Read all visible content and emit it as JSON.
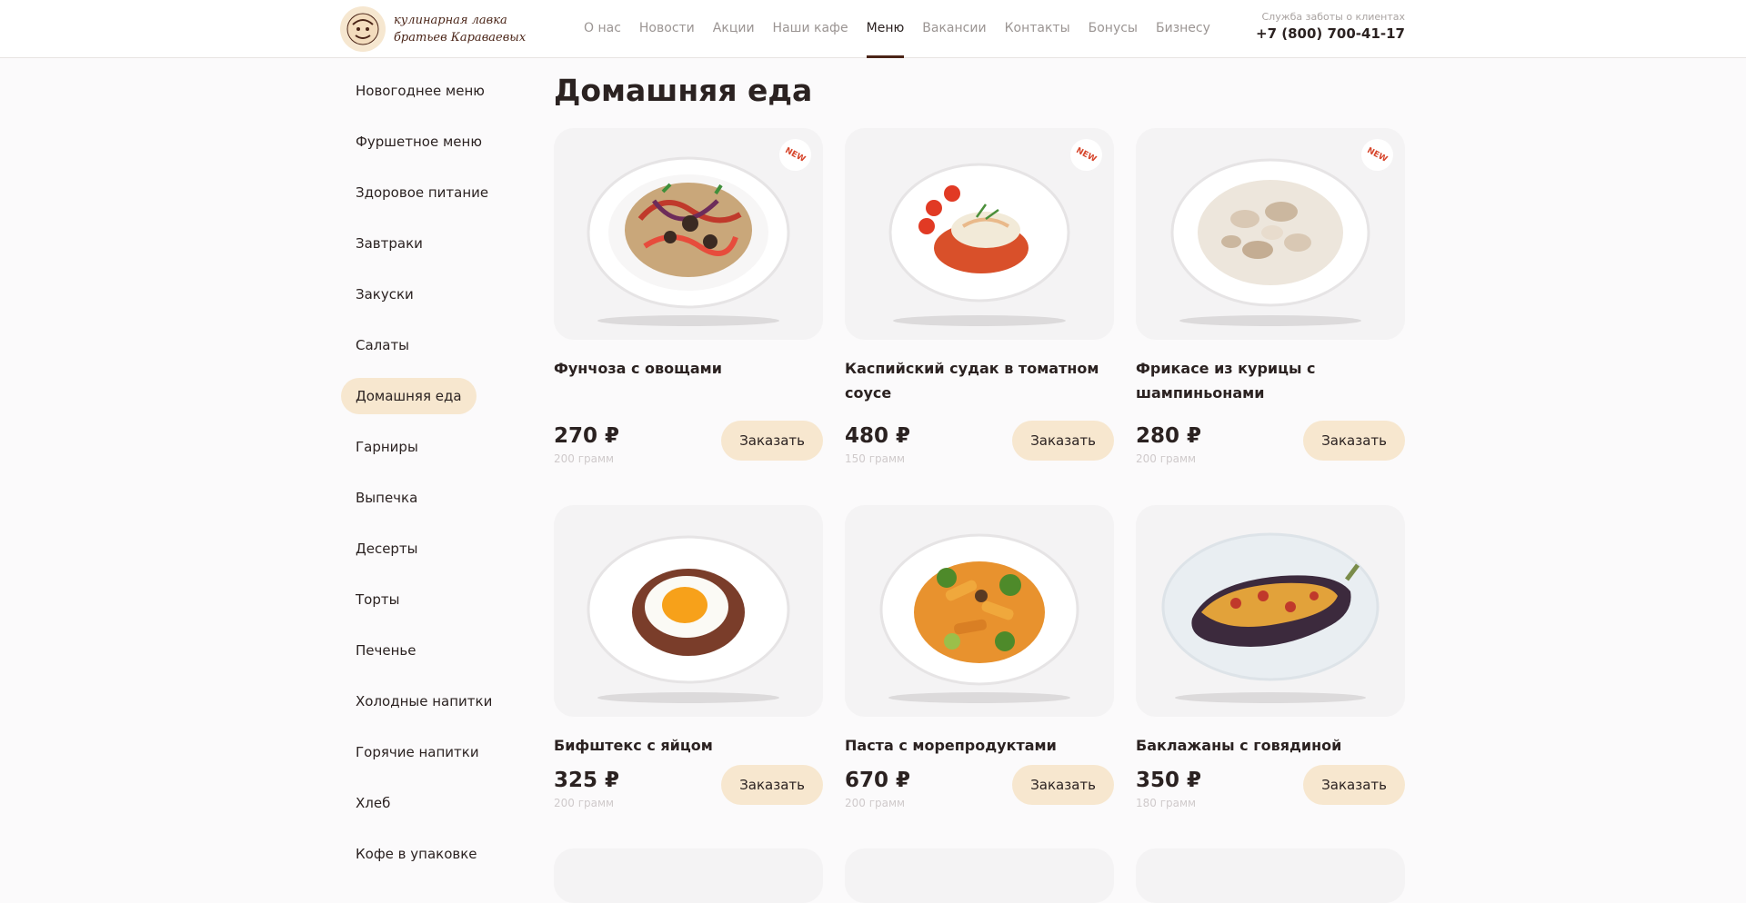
{
  "header": {
    "logo_text": "кулинарная лавка\nбратьев Караваевых",
    "nav": [
      "О нас",
      "Новости",
      "Акции",
      "Наши кафе",
      "Меню",
      "Вакансии",
      "Контакты",
      "Бонусы",
      "Бизнесу"
    ],
    "active_nav": "Меню",
    "support_label": "Служба заботы о клиентах",
    "phone": "+7 (800) 700-41-17"
  },
  "sidebar": {
    "items": [
      "Новогоднее меню",
      "Фуршетное меню",
      "Здоровое питание",
      "Завтраки",
      "Закуски",
      "Салаты",
      "Домашняя еда",
      "Гарниры",
      "Выпечка",
      "Десерты",
      "Торты",
      "Печенье",
      "Холодные напитки",
      "Горячие напитки",
      "Хлеб",
      "Кофе в упаковке"
    ],
    "active": "Домашняя еда"
  },
  "main": {
    "title": "Домашняя еда",
    "order_label": "Заказать",
    "new_label": "NEW",
    "products": [
      {
        "name": "Фунчоза с овощами",
        "price": "270 ₽",
        "weight": "200 грамм",
        "is_new": true
      },
      {
        "name": "Каспийский судак в томатном соусе",
        "price": "480 ₽",
        "weight": "150 грамм",
        "is_new": true
      },
      {
        "name": "Фрикасе из курицы с шампиньонами",
        "price": "280 ₽",
        "weight": "200 грамм",
        "is_new": true
      },
      {
        "name": "Бифштекс с яйцом",
        "price": "325 ₽",
        "weight": "200 грамм",
        "is_new": false
      },
      {
        "name": "Паста с морепродуктами",
        "price": "670 ₽",
        "weight": "200 грамм",
        "is_new": false
      },
      {
        "name": "Баклажаны с говядиной",
        "price": "350 ₽",
        "weight": "180 грамм",
        "is_new": false
      }
    ]
  },
  "colors": {
    "accent": "#f7e7cf",
    "brand": "#4a2417",
    "new_badge": "#d6442a",
    "muted_text": "#9b9593"
  }
}
